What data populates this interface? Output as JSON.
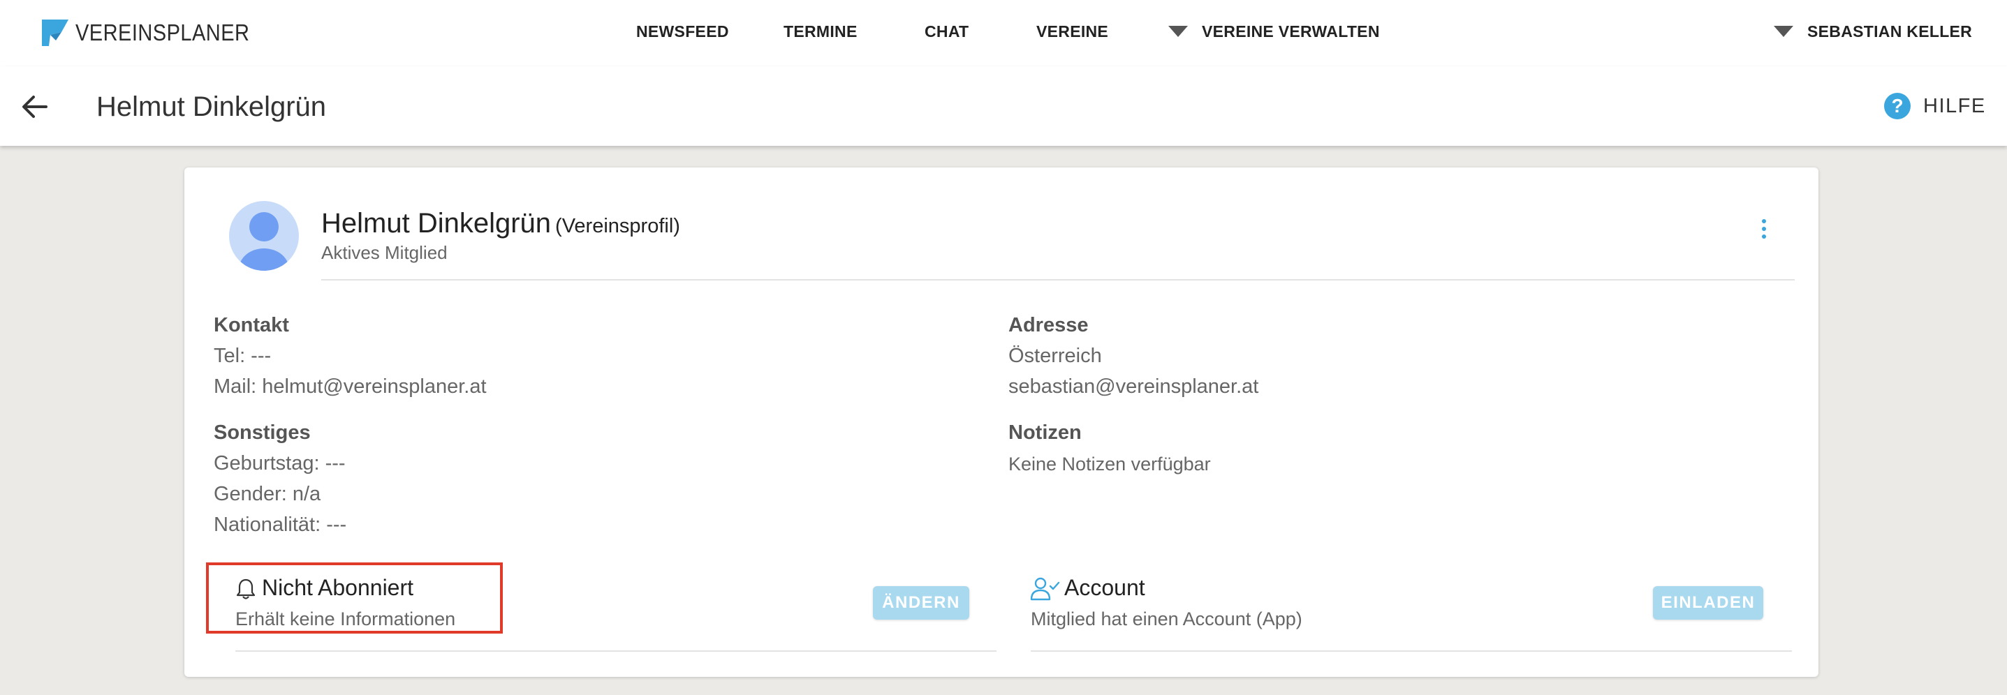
{
  "app": {
    "logo_text": "VEREINSPLANER",
    "nav": [
      "NEWSFEED",
      "TERMINE",
      "CHAT",
      "VEREINE"
    ],
    "manage_label": "VEREINE VERWALTEN",
    "user_name": "SEBASTIAN KELLER"
  },
  "header": {
    "title": "Helmut Dinkelgrün",
    "help_label": "HILFE",
    "help_glyph": "?"
  },
  "profile": {
    "name": "Helmut Dinkelgrün",
    "tag": "(Vereinsprofil)",
    "status": "Aktives Mitglied"
  },
  "kontakt": {
    "title": "Kontakt",
    "tel": "Tel: ---",
    "mail": "Mail: helmut@vereinsplaner.at"
  },
  "adresse": {
    "title": "Adresse",
    "country": "Österreich",
    "email": "sebastian@vereinsplaner.at"
  },
  "sonstiges": {
    "title": "Sonstiges",
    "birthday": "Geburtstag: ---",
    "gender": "Gender: n/a",
    "nationality": "Nationalität: ---"
  },
  "notizen": {
    "title": "Notizen",
    "text": "Keine Notizen verfügbar"
  },
  "subscription": {
    "title": "Nicht Abonniert",
    "subtitle": "Erhält keine Informationen",
    "button": "ÄNDERN"
  },
  "account": {
    "title": "Account",
    "subtitle": "Mitglied hat einen Account (App)",
    "button": "EINLADEN"
  },
  "colors": {
    "accent": "#3aa6dd",
    "button_disabled": "#a9d9ef",
    "highlight": "#e03a2b",
    "background": "#eceae7"
  },
  "icons": [
    "logo-mark",
    "arrow-left-icon",
    "help-icon",
    "more-vert-icon",
    "bell-icon",
    "user-check-icon",
    "caret-down-icon"
  ]
}
